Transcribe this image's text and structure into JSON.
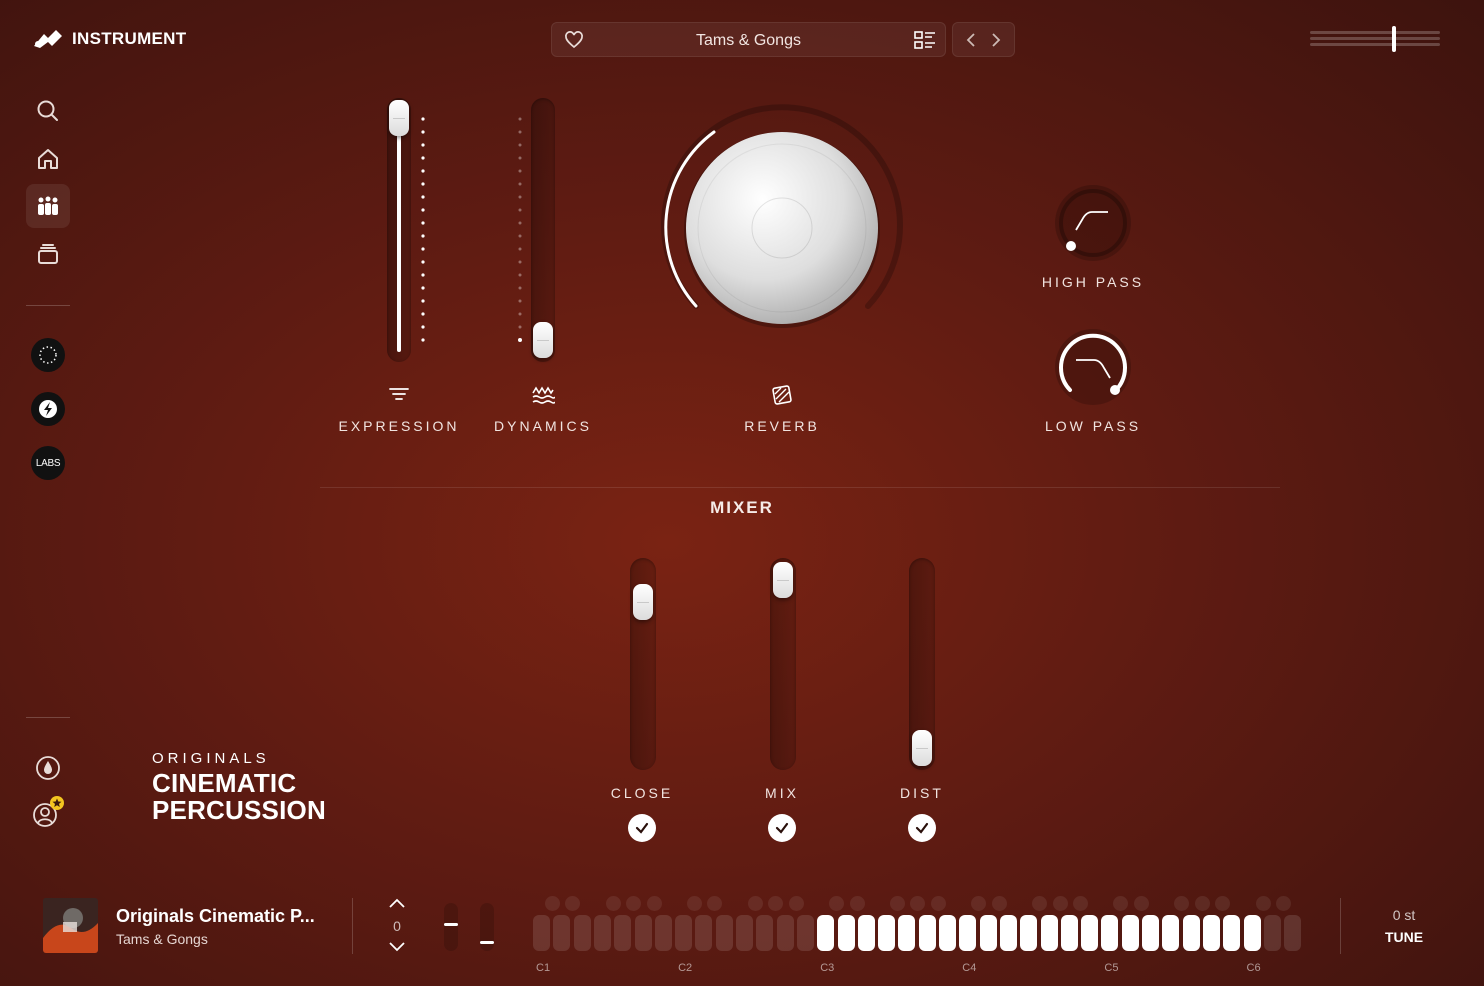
{
  "app": {
    "brand": "INSTRUMENT"
  },
  "sidebar": {
    "items": [
      {
        "name": "search",
        "icon": "search-icon"
      },
      {
        "name": "home",
        "icon": "home-icon"
      },
      {
        "name": "instruments",
        "icon": "instruments-icon",
        "active": true
      },
      {
        "name": "library",
        "icon": "stack-icon"
      }
    ],
    "badges": [
      {
        "name": "mysteries-badge",
        "label": ""
      },
      {
        "name": "brand-s-badge",
        "label": ""
      },
      {
        "name": "labs-badge",
        "label": "LABS"
      }
    ],
    "bottom": [
      {
        "name": "ink",
        "icon": "drop-icon"
      },
      {
        "name": "account",
        "icon": "user-star-icon"
      }
    ]
  },
  "preset": {
    "name": "Tams & Gongs",
    "favorite": false
  },
  "master_volume": {
    "level": 0.65
  },
  "controls": {
    "expression": {
      "label": "EXPRESSION",
      "value": 1.0
    },
    "dynamics": {
      "label": "DYNAMICS",
      "value": 0.0
    },
    "reverb": {
      "label": "REVERB",
      "value": 0.5
    },
    "high_pass": {
      "label": "HIGH PASS",
      "value": 0.0
    },
    "low_pass": {
      "label": "LOW PASS",
      "value": 1.0
    }
  },
  "mixer": {
    "title": "MIXER",
    "channels": [
      {
        "label": "CLOSE",
        "level": 0.85,
        "enabled": true
      },
      {
        "label": "MIX",
        "level": 0.97,
        "enabled": true
      },
      {
        "label": "DIST",
        "level": 0.12,
        "enabled": true
      }
    ]
  },
  "product": {
    "brand_line": "ORIGINALS",
    "title_line1": "CINEMATIC",
    "title_line2": "PERCUSSION"
  },
  "footer": {
    "track_title": "Originals Cinematic P...",
    "track_subtitle": "Tams & Gongs",
    "octave_value": "0",
    "octave_labels": [
      "C1",
      "C2",
      "C3",
      "C4",
      "C5",
      "C6"
    ],
    "tune_value": "0 st",
    "tune_label": "TUNE"
  },
  "colors": {
    "background": "#6b1f14",
    "accent": "#ffffff"
  }
}
